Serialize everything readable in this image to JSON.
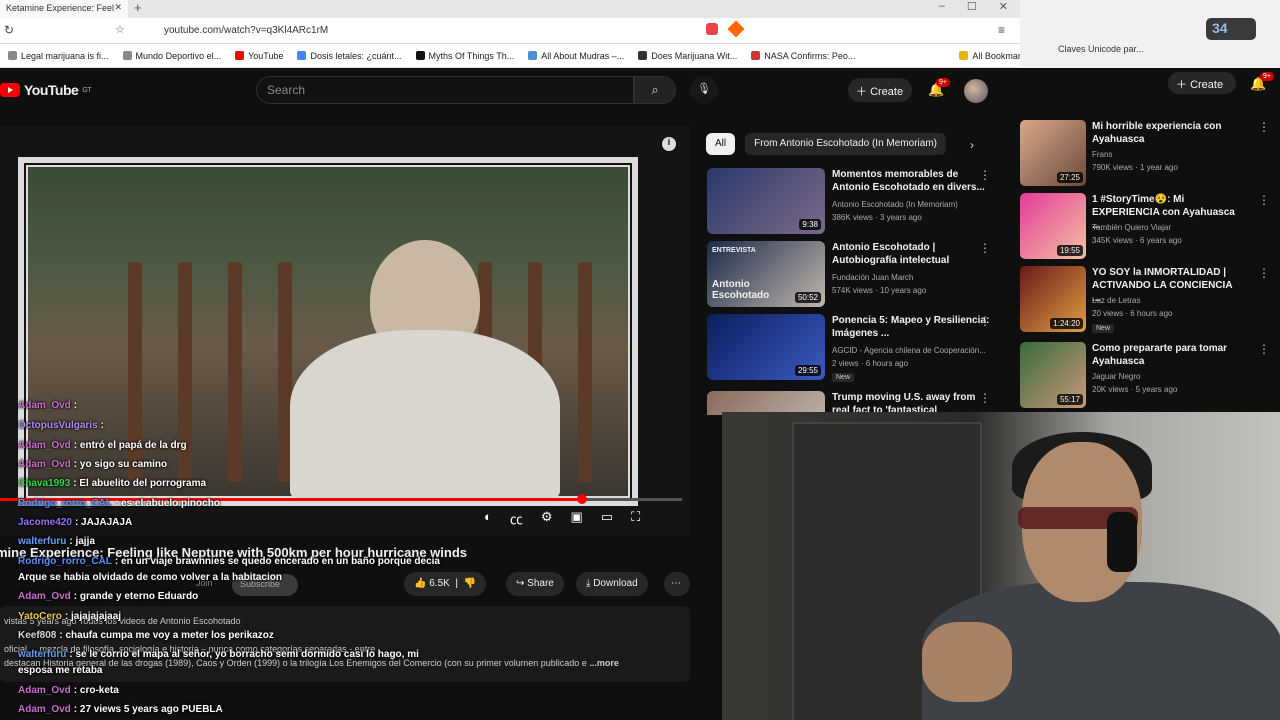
{
  "browser": {
    "tab_title": "Ketamine Experience: Feel",
    "url": "youtube.com/watch?v=q3Kl4ARc1rM",
    "bookmarks": [
      "Legal marijuana is fi...",
      "Mundo Deportivo el...",
      "YouTube",
      "Dosis letales: ¿cuánt...",
      "Myths Of Things Th...",
      "All About Mudras –...",
      "Does Marijuana Wit...",
      "NASA Confirms: Peo..."
    ],
    "all_bookmarks": "All Bookmarks",
    "right_bookmark": "Claves Unicode par...",
    "ext_badge": "34"
  },
  "youtube": {
    "logo": "YouTube",
    "region": "GT",
    "search_placeholder": "Search",
    "create_label": "Create",
    "notif_count": "9+"
  },
  "player": {
    "title": "mine Experience: Feeling like Neptune with 500km per hour hurricane winds",
    "progress": 0.853,
    "join": "Join",
    "subscribe": "Subscribe",
    "likes": "6.5K",
    "share": "Share",
    "download": "Download"
  },
  "description": {
    "line1": "vistas  5 years ago  Todos los videos de Antonio Escohotado",
    "line2": "oficial ... mezcla de filosofía, sociología e historia – nunca como categorías separadas - entre",
    "line3": "destacan Historia general de las drogas (1989), Caos y Orden (1999) o la trilogía Los Enemigos del Comercio (con su primer volumen publicado e",
    "more": "...more"
  },
  "chat": [
    {
      "user": "Adam_Ovd",
      "text": "",
      "color": "#c96fc9"
    },
    {
      "user": "OctopusVulgaris",
      "text": "",
      "color": "#b38cf0"
    },
    {
      "user": "Adam_Ovd",
      "text": "entró el papá de la drg",
      "color": "#c96fc9"
    },
    {
      "user": "Adam_Ovd",
      "text": "yo sigo su camino",
      "color": "#c96fc9"
    },
    {
      "user": "Chava1993",
      "text": "El abuelito del porrograma",
      "color": "#36d94a"
    },
    {
      "user": "Rodrigo_rorro_CAL",
      "text": "es el abuelo pinocho",
      "color": "#5b8cff"
    },
    {
      "user": "Jacome420",
      "text": "JAJAJAJA",
      "color": "#9b6ff5"
    },
    {
      "user": "walterfuru",
      "text": "jajja",
      "color": "#6f9cf5"
    },
    {
      "user": "Rodrigo_rorro_CAL",
      "text": "en un viaje brawnnies se quedo encerado en un baño porque decia",
      "color": "#5b8cff"
    },
    {
      "user": "",
      "text": "Arque se habia olvidado de como volver a la habitacion",
      "color": "#fff"
    },
    {
      "user": "Adam_Ovd",
      "text": "grande y eterno Eduardo",
      "color": "#c96fc9"
    },
    {
      "user": "YatoCero",
      "text": "jajajajajaaj",
      "color": "#e6c94a"
    },
    {
      "user": "Keef808",
      "text": "chaufa cumpa me voy a meter los perikazoz",
      "color": "#d6d6d6"
    },
    {
      "user": "walterfuru",
      "text": "se le corrio el mapa al señor, yo borracho semi dormido casi lo hago, mi",
      "color": "#6f9cf5"
    },
    {
      "user": "",
      "text": "esposa me retaba",
      "color": "#fff"
    },
    {
      "user": "Adam_Ovd",
      "text": "cro-keta",
      "color": "#c96fc9"
    },
    {
      "user": "Adam_Ovd",
      "text": "27 views  5 years ago  PUEBLA",
      "color": "#c96fc9"
    }
  ],
  "chips": {
    "all": "All",
    "channel": "From Antonio Escohotado (In Memoriam)"
  },
  "recs": [
    {
      "title": "Momentos memorables de Antonio Escohotado en divers...",
      "channel": "Antonio Escohotado (In Memoriam)",
      "meta": "386K views · 3 years ago",
      "duration": "9:38",
      "badge": ""
    },
    {
      "title": "Antonio Escohotado | Autobiografía intelectual",
      "channel": "Fundación Juan March",
      "meta": "574K views · 10 years ago",
      "duration": "50:52",
      "badge": "",
      "thumb_label": "ENTREVISTA",
      "thumb_name": "Antonio Escohotado"
    },
    {
      "title": "Ponencia 5: Mapeo y Resiliencia: Imágenes ...",
      "channel": "AGCID - Agencia chilena de Cooperación...",
      "meta": "2 views · 6 hours ago",
      "duration": "29:55",
      "badge": "New"
    },
    {
      "title": "Trump moving U.S. away from real fact to 'fantastical",
      "channel": "",
      "meta": "",
      "duration": "",
      "badge": ""
    }
  ],
  "right_recs": [
    {
      "title": "Mi horrible experiencia con Ayahuasca",
      "channel": "Frans",
      "meta": "790K views · 1 year ago",
      "duration": "27:25",
      "badge": ""
    },
    {
      "title": "1 #StoryTime😵: Mi EXPERIENCIA con Ayahuasca ...",
      "channel": "También Quiero Viajar",
      "meta": "345K views · 6 years ago",
      "duration": "19:55",
      "badge": ""
    },
    {
      "title": "YO SOY la INMORTALIDAD | ACTIVANDO LA CONCIENCIA ...",
      "channel": "Luz de Letras",
      "meta": "20 views · 6 hours ago",
      "duration": "1:24:20",
      "badge": "New"
    },
    {
      "title": "Como prepararte para tomar Ayahuasca",
      "channel": "Jaguar Negro",
      "meta": "20K views · 5 years ago",
      "duration": "55:17",
      "badge": ""
    }
  ],
  "colors": {
    "accent": "#ff0000",
    "bg": "#0f0f0f"
  }
}
